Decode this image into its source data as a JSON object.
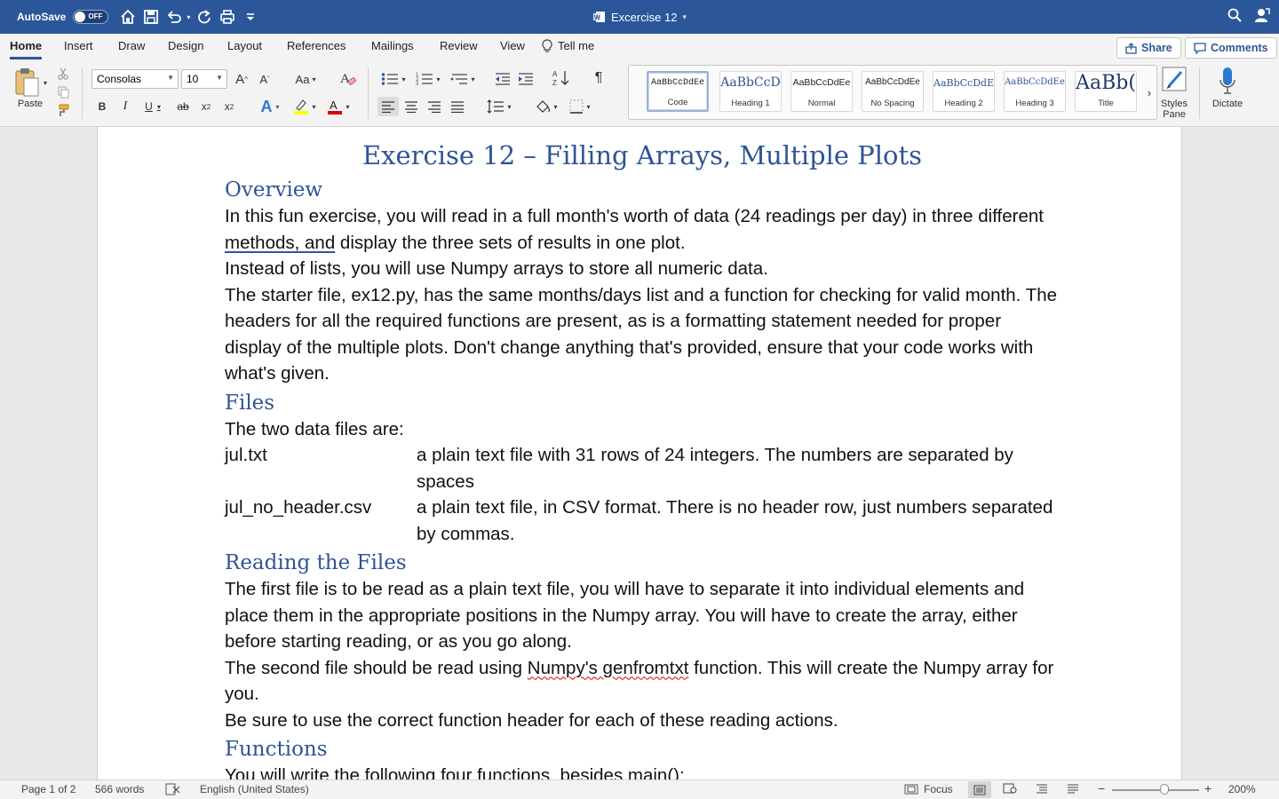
{
  "titlebar": {
    "autosave_label": "AutoSave",
    "autosave_state": "OFF",
    "doc_title": "Excercise 12",
    "icons": [
      "home-icon",
      "save-icon",
      "undo-icon",
      "redo-icon",
      "print-icon",
      "customize-icon",
      "search-icon",
      "account-icon"
    ]
  },
  "tabs": [
    {
      "label": "Home",
      "active": true
    },
    {
      "label": "Insert"
    },
    {
      "label": "Draw"
    },
    {
      "label": "Design"
    },
    {
      "label": "Layout"
    },
    {
      "label": "References"
    },
    {
      "label": "Mailings"
    },
    {
      "label": "Review"
    },
    {
      "label": "View"
    },
    {
      "label": "Tell me"
    }
  ],
  "share_label": "Share",
  "comments_label": "Comments",
  "ribbon": {
    "paste_label": "Paste",
    "font_name": "Consolas",
    "font_size": "10",
    "styles": [
      {
        "sample": "AaBbCcDdEe",
        "label": "Code"
      },
      {
        "sample": "AaBbCcD",
        "label": "Heading 1"
      },
      {
        "sample": "AaBbCcDdEe",
        "label": "Normal"
      },
      {
        "sample": "AaBbCcDdEe",
        "label": "No Spacing"
      },
      {
        "sample": "AaBbCcDdE",
        "label": "Heading 2"
      },
      {
        "sample": "AaBbCcDdEe",
        "label": "Heading 3"
      },
      {
        "sample": "AaBb(",
        "label": "Title"
      }
    ],
    "styles_pane_label": "Styles Pane",
    "dictate_label": "Dictate",
    "accent_color": "#2b579a",
    "highlight_color": "#ffff00",
    "font_color": "#e00000"
  },
  "doc": {
    "title": "Exercise 12 – Filling Arrays, Multiple Plots",
    "overview_heading": "Overview",
    "overview_p1_a": "In this fun exercise, you will read in a full month's worth of data (24 readings per day) in three different ",
    "overview_p1_u": "methods, and",
    "overview_p1_b": " display the three sets of results in one plot.",
    "overview_p2": "Instead of lists, you will use Numpy arrays to store all numeric data.",
    "overview_p3": "The starter file, ex12.py, has the same months/days list and a function for checking for valid month. The headers for all the required functions are present, as is a formatting statement needed for proper display of the multiple plots. Don't change anything that's provided, ensure that your code works with what's given.",
    "files_heading": "Files",
    "files_intro": "The two data files are:",
    "files": [
      {
        "name": "jul.txt",
        "desc": "a plain text file with 31 rows of 24 integers. The numbers are separated by spaces"
      },
      {
        "name": "jul_no_header.csv",
        "desc": "a plain text file, in CSV format. There is no header row, just numbers separated by commas."
      }
    ],
    "reading_heading": "Reading the Files",
    "reading_p1": "The first file is to be read as a plain text file, you will have to separate it into individual elements and place them in the appropriate positions in the Numpy array. You will have to create the array, either before starting reading, or as you go along.",
    "reading_p2_a": "The second file should be read using ",
    "reading_p2_u": "Numpy's genfromtxt",
    "reading_p2_b": " function. This will create the Numpy array for you.",
    "reading_p3": "Be sure to use the correct function header for each of these reading actions.",
    "functions_heading": "Functions",
    "functions_p1": "You will write the following four functions, besides main():"
  },
  "status": {
    "page": "Page 1 of 2",
    "words": "566 words",
    "language": "English (United States)",
    "focus": "Focus",
    "zoom": "200%"
  }
}
